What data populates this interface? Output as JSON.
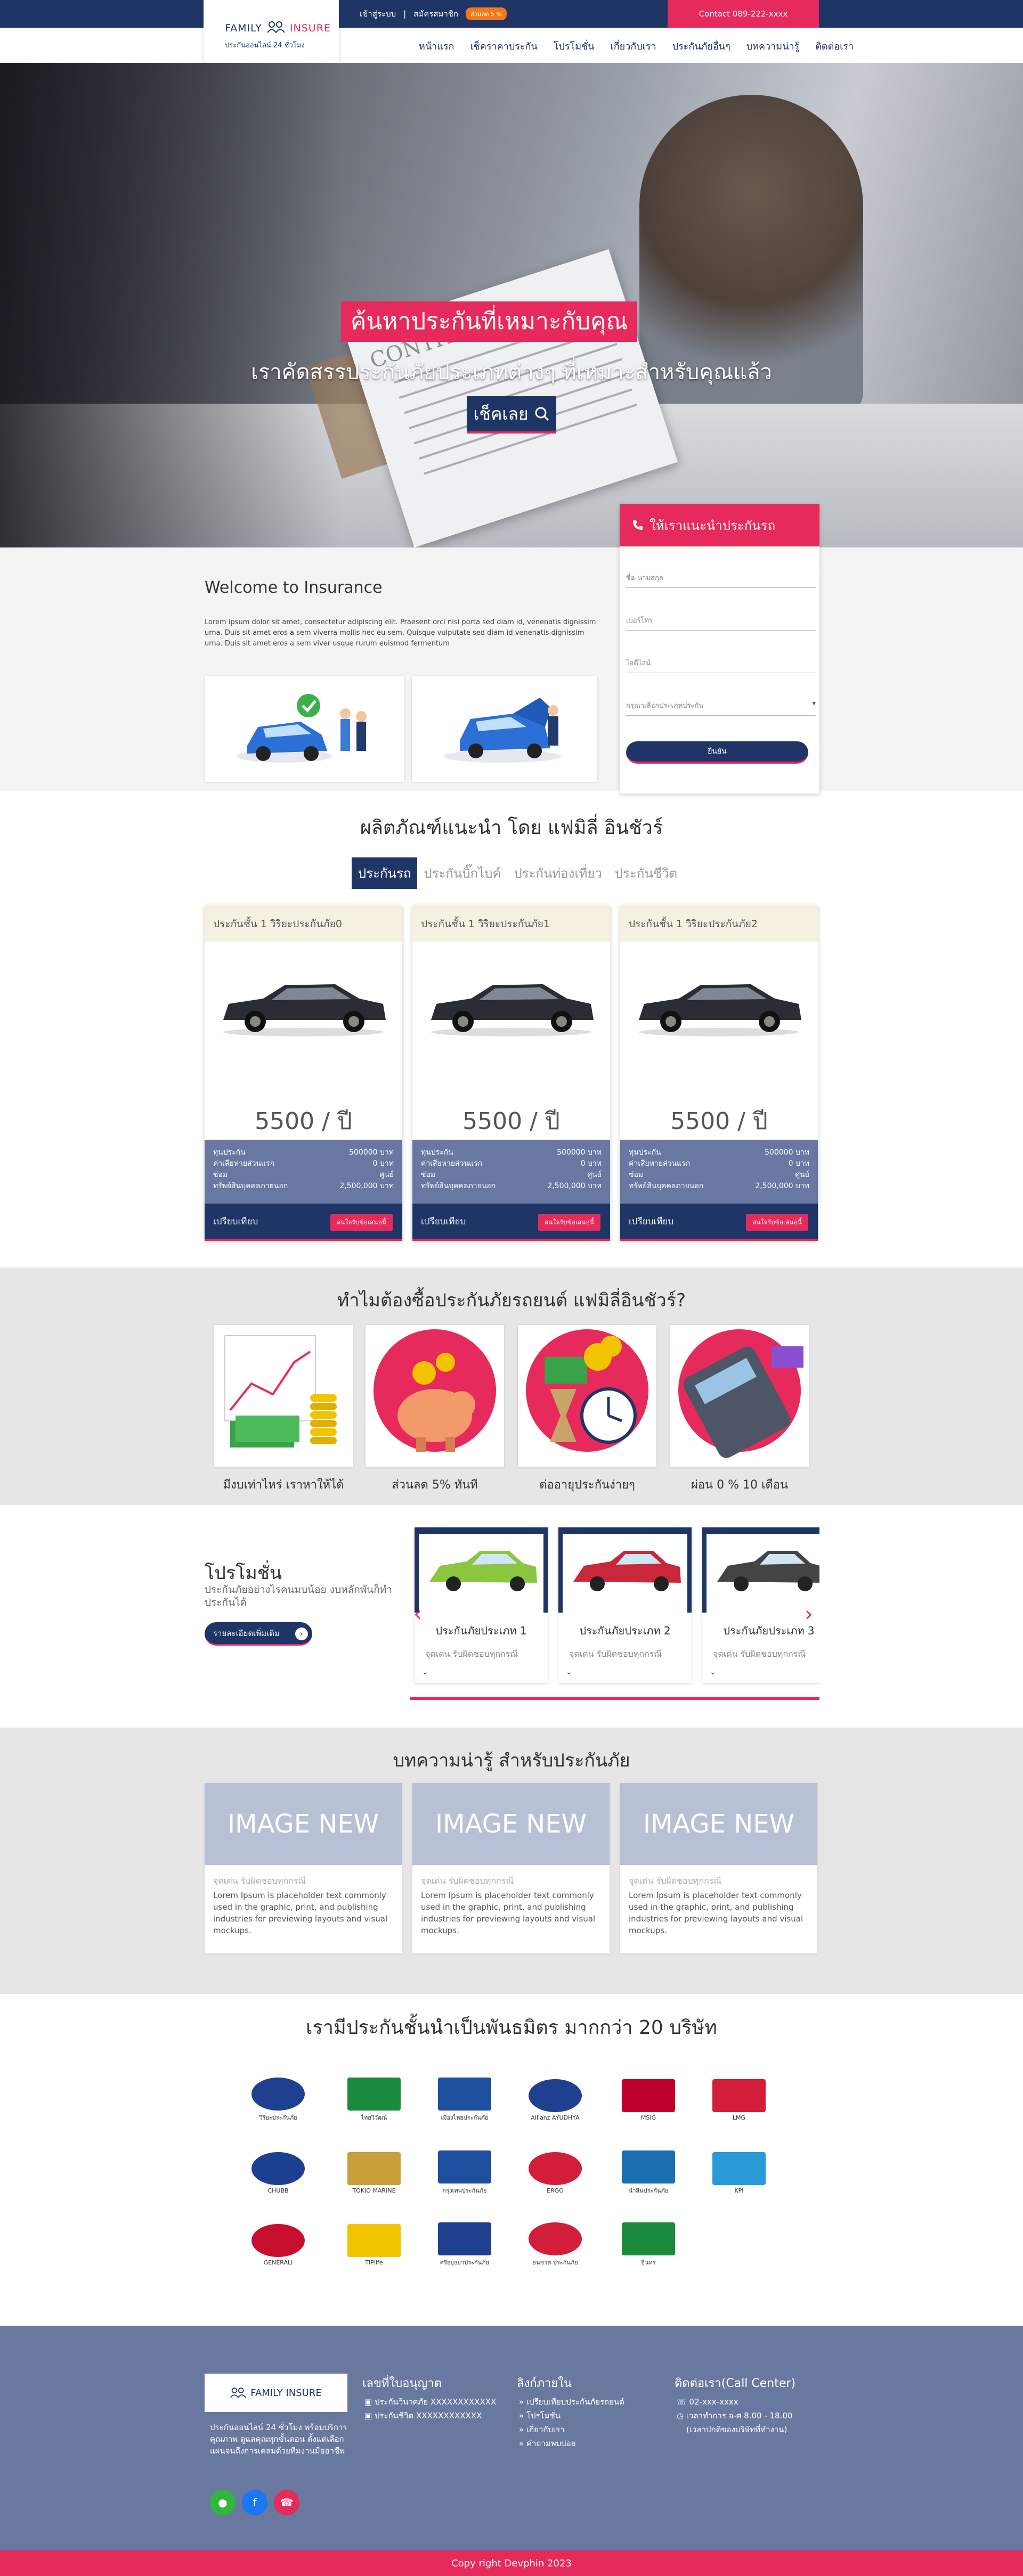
{
  "topbar": {
    "login": "เข้าสู่ระบบ",
    "separator": "|",
    "register": "สมัครสมาชิก",
    "discount_badge": "ส่วนลด 5 %",
    "contact": "Contact 089-222-xxxx"
  },
  "logo": {
    "brand_a": "FAMILY",
    "brand_b": "INSURE",
    "tagline": "ประกันออนไลน์ 24 ชั่วโมง"
  },
  "nav": [
    "หน้าแรก",
    "เช็คราคาประกัน",
    "โปรโมชั่น",
    "เกี่ยวกับเรา",
    "ประกันภัยอื่นๆ",
    "บทความน่ารู้",
    "ติดต่อเรา"
  ],
  "hero": {
    "title": "ค้นหาประกันที่เหมาะกับคุณ",
    "subtitle": "เราคัดสรรประกันภัยประเภทต่างๆ ที่เหมาะสำหรับคุณแล้ว",
    "button": "เช็คเลย",
    "paper_text": "CONTRACT"
  },
  "welcome": {
    "title": "Welcome to Insurance",
    "text": "Lorem ipsum dolor sit amet, consectetur adipiscing elit. Praesent orci nisi porta sed diam id, venenatis dignissim urna. Duis sit amet eros a sem viverra mollis nec eu sem. Quisque vulputate sed diam id venenatis dignissim urna. Duis sit amet eros a sem viver usque rurum euismod fermentum"
  },
  "form": {
    "title": "ให้เราแนะนำประกันรถ",
    "name_ph": "ชื่อ-นามสกุล",
    "phone_ph": "เบอร์โทร",
    "line_ph": "ไอดีไลน์",
    "type_ph": "กรุณาเลือกประเภทประกัน",
    "submit": "ยืนยัน"
  },
  "products": {
    "title": "ผลิตภัณฑ์แนะนำ โดย แฟมิลี่ อินชัวร์",
    "tabs": [
      "ประกันรถ",
      "ประกันบิ๊กไบค์",
      "ประกันท่องเที่ยว",
      "ประกันชีวิต"
    ],
    "items": [
      {
        "name": "ประกันชั้น 1 วิริยะประกันภัย0",
        "price": "5500 / ปี"
      },
      {
        "name": "ประกันชั้น 1 วิริยะประกันภัย1",
        "price": "5500 / ปี"
      },
      {
        "name": "ประกันชั้น 1 วิริยะประกันภัย2",
        "price": "5500 / ปี"
      }
    ],
    "rows": [
      {
        "k": "ทุนประกัน",
        "v": "500000 บาท"
      },
      {
        "k": "ค่าเสียหายส่วนแรก",
        "v": "0 บาท"
      },
      {
        "k": "ซ่อม",
        "v": "ศูนย์"
      },
      {
        "k": "ทรัพย์สินบุคคลภายนอก",
        "v": "2,500,000 บาท"
      }
    ],
    "compare": "เปรียบเทียบ",
    "buy": "สนใจรับข้อเสนอนี้"
  },
  "why": {
    "title": "ทำไมต้องซื้อประกันภัยรถยนต์ แฟมิลี่อินชัวร์?",
    "items": [
      "มีงบเท่าไหร่ เราหาให้ได้",
      "ส่วนลด 5% ทันที",
      "ต่ออายุประกันง่ายๆ",
      "ผ่อน 0 % 10 เดือน"
    ]
  },
  "promo": {
    "title": "โปรโมชั่น",
    "subtitle": "ประกันภัยอย่างไรคนมบน้อย งบหลักพันก็ทำประกันได้",
    "more": "รายละเอียดเพิ่มเติม",
    "slides": [
      {
        "title": "ประกันภัยประเภท 1",
        "desc": "จุดเด่น รับผิดชอบทุกกรณี"
      },
      {
        "title": "ประกันภัยประเภท 2",
        "desc": "จุดเด่น รับผิดชอบทุกกรณี"
      },
      {
        "title": "ประกันภัยประเภท 3",
        "desc": "จุดเด่น รับผิดชอบทุกกรณี"
      }
    ]
  },
  "articles": {
    "title": "บทความน่ารู้ สำหรับประกันภัย",
    "img_text": "IMAGE NEW",
    "caption": "จุดเด่น รับผิดชอบทุกกรณี",
    "body": "Lorem Ipsum is placeholder text commonly used in the graphic, print, and publishing industries for previewing layouts and visual mockups."
  },
  "partners": {
    "title": "เรามีประกันชั้นนำเป็นพันธมิตร มากกว่า 20 บริษัท",
    "logos": [
      {
        "name": "วิริยะประกันภัย",
        "color": "#1f3f8f"
      },
      {
        "name": "ไทยวิวัฒน์",
        "color": "#1c8a3c"
      },
      {
        "name": "เมืองไทยประกันภัย",
        "color": "#1f4f9f"
      },
      {
        "name": "Allianz AYUDHYA",
        "color": "#1f3f8f"
      },
      {
        "name": "MSIG",
        "color": "#c0002b"
      },
      {
        "name": "LMG",
        "color": "#d21e3a"
      },
      {
        "name": "CHUBB",
        "color": "#1d3f8f"
      },
      {
        "name": "TOKIO MARINE",
        "color": "#c99f3a"
      },
      {
        "name": "กรุงเทพประกันภัย",
        "color": "#1f4f9f"
      },
      {
        "name": "ERGO",
        "color": "#d21e3a"
      },
      {
        "name": "นำสินประกันภัย",
        "color": "#1a6fb3"
      },
      {
        "name": "KPI",
        "color": "#2a9ad6"
      },
      {
        "name": "GENERALI",
        "color": "#c8102e"
      },
      {
        "name": "TIPlife",
        "color": "#f2c300"
      },
      {
        "name": "ศรีอยุธยาประกันภัย",
        "color": "#1f3f8f"
      },
      {
        "name": "ธนชาต ประกันภัย",
        "color": "#d21e3a"
      },
      {
        "name": "อินทร",
        "color": "#1c8a3c"
      }
    ]
  },
  "footer": {
    "brand": "FAMILY INSURE",
    "desc": "ประกันออนไลน์ 24 ชั่วโมง พร้อมบริการคุณภาพ ดูแลคุณทุกขั้นตอน ตั้งแต่เลือกแผนจนถึงการเคลมด้วยทีมงานมืออาชีพ",
    "license_title": "เลขที่ใบอนุญาต",
    "licenses": [
      "ประกันวินาศภัย XXXXXXXXXXXX",
      "ประกันชีวิต XXXXXXXXXXXX"
    ],
    "links_title": "ลิงก์ภายใน",
    "links": [
      "เปรียบเทียบประกันภัยรถยนต์",
      "โปรโมชั่น",
      "เกี่ยวกับเรา",
      "คำถามพบบ่อย"
    ],
    "contact_title": "ติดต่อเรา(Call Center)",
    "phone": "02-xxx-xxxx",
    "hours": "เวลาทำการ จ-ศ 8.00 - 18.00",
    "hours2": "(เวลาปกติของบริษัทที่ทำงาน)",
    "copyright": "Copy right Devphin 2023"
  }
}
